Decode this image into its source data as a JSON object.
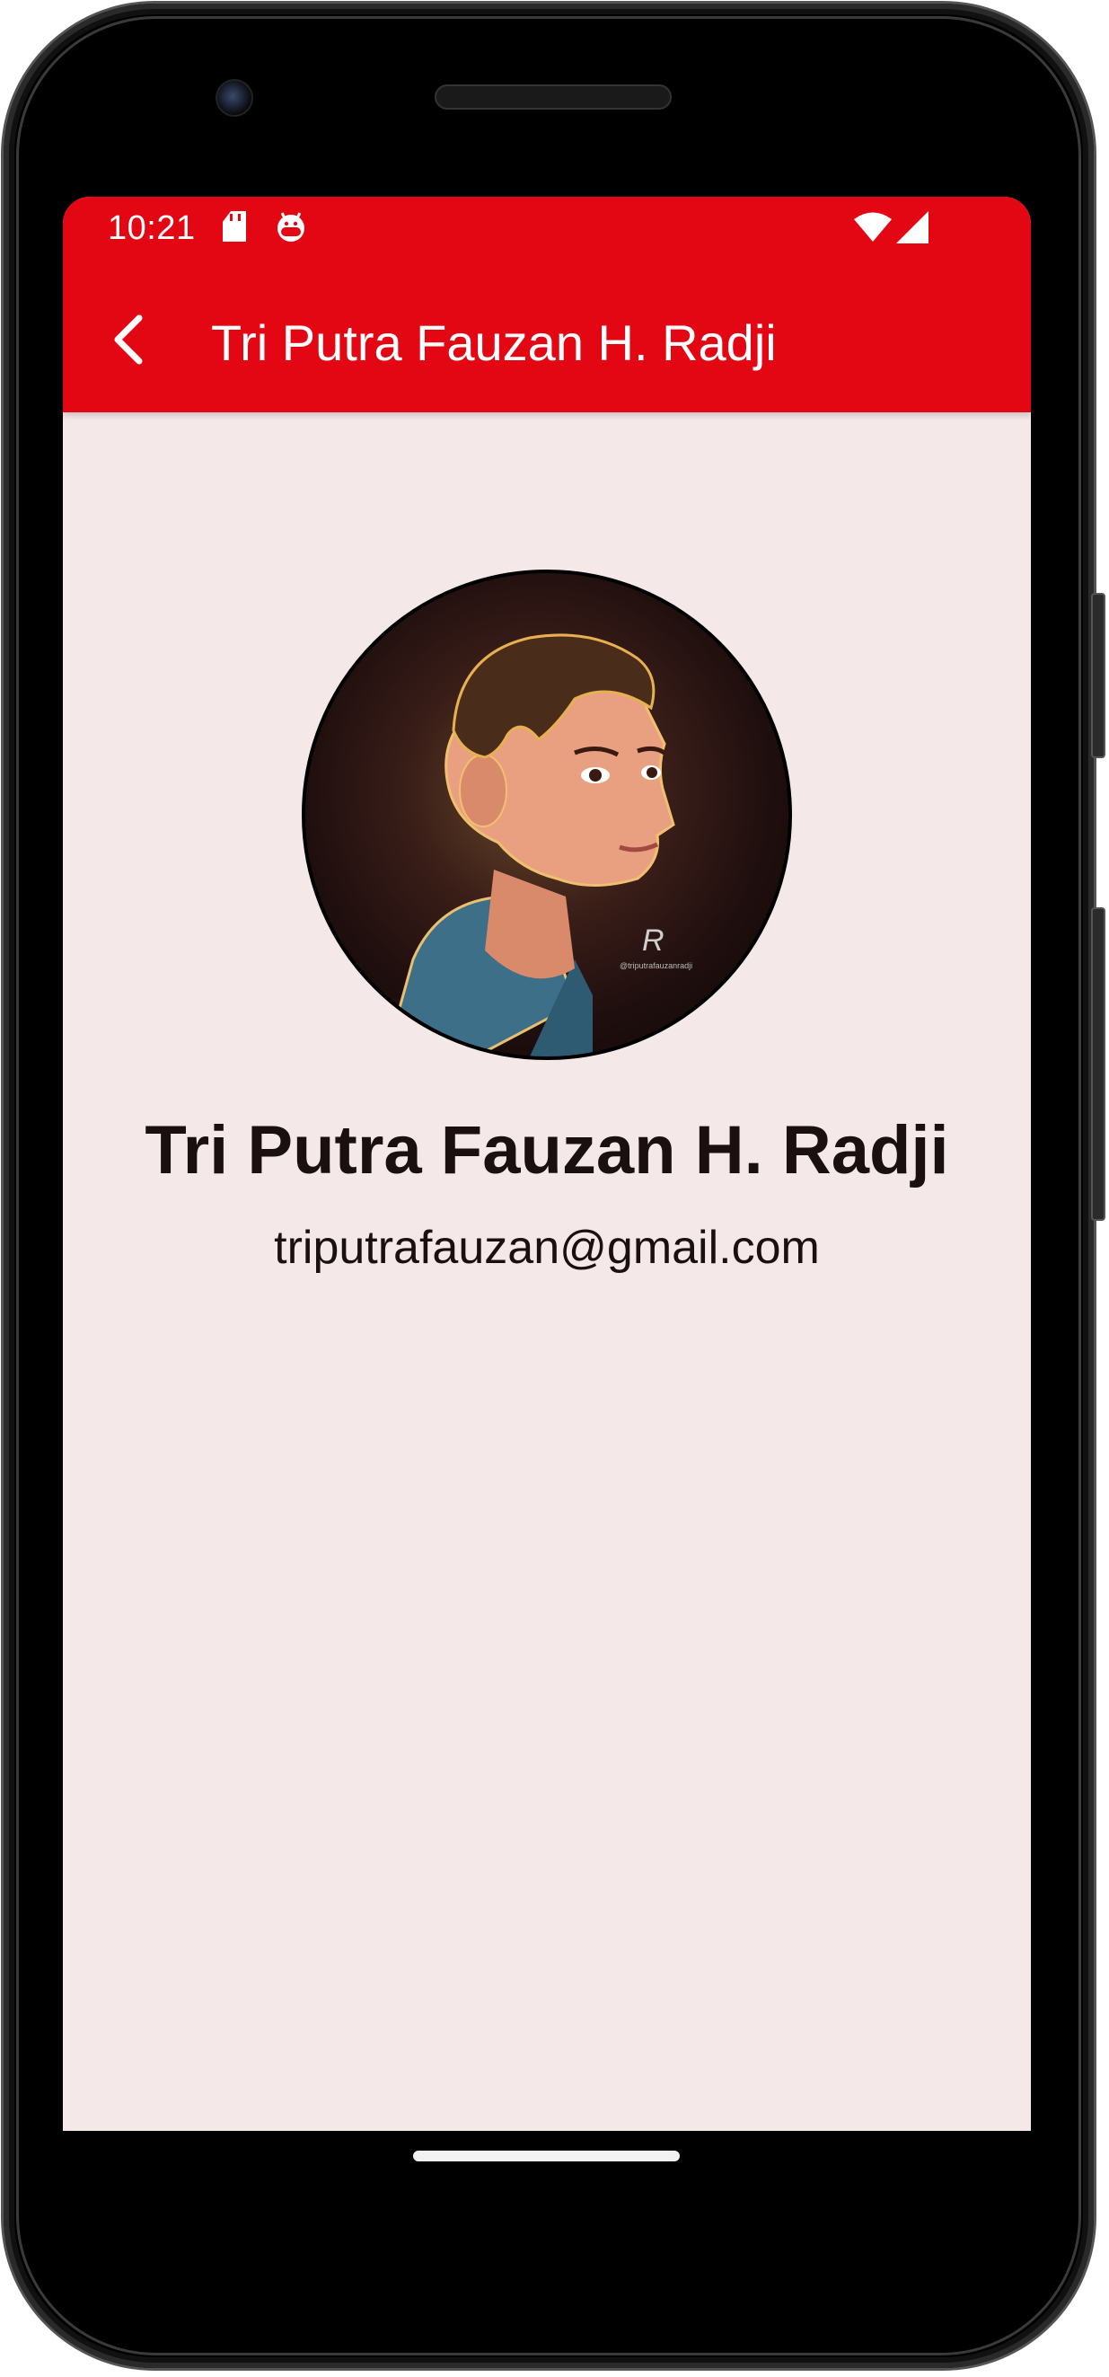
{
  "status_bar": {
    "time": "10:21",
    "icons": [
      "sd-card-icon",
      "android-bot-icon",
      "wifi-icon",
      "cell-signal-icon"
    ]
  },
  "app_bar": {
    "title": "Tri Putra Fauzan H. Radji",
    "back_icon": "back-arrow-icon"
  },
  "profile": {
    "avatar": "cartoon-avatar-portrait",
    "avatar_signature": "@triputrafauzanradji",
    "name": "Tri Putra Fauzan H. Radji",
    "email": "triputrafauzan@gmail.com"
  },
  "colors": {
    "accent": "#e30613",
    "background": "#f5e8e8",
    "text": "#1a1010"
  }
}
